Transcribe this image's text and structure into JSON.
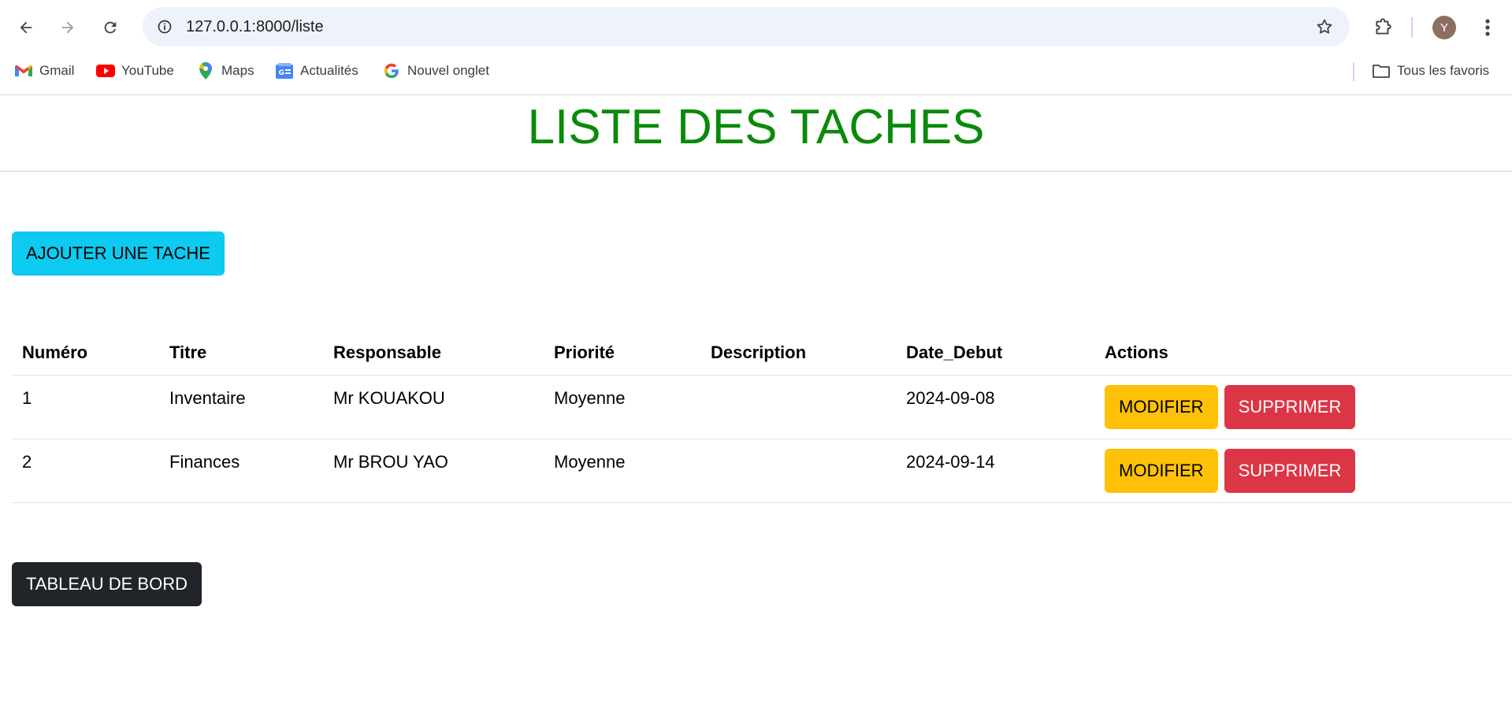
{
  "browser": {
    "url": "127.0.0.1:8000/liste",
    "avatar_letter": "Y",
    "bookmarks": [
      {
        "label": "Gmail",
        "icon": "gmail-icon"
      },
      {
        "label": "YouTube",
        "icon": "youtube-icon"
      },
      {
        "label": "Maps",
        "icon": "maps-icon"
      },
      {
        "label": "Actualités",
        "icon": "news-icon"
      },
      {
        "label": "Nouvel onglet",
        "icon": "google-icon"
      }
    ],
    "all_bookmarks_label": "Tous les favoris"
  },
  "page": {
    "title": "LISTE DES TACHES",
    "add_button": "AJOUTER UNE TACHE",
    "dashboard_button": "TABLEAU DE BORD",
    "title_color": "#0a8a0a"
  },
  "table": {
    "headers": [
      "Numéro",
      "Titre",
      "Responsable",
      "Priorité",
      "Description",
      "Date_Debut",
      "Actions"
    ],
    "rows": [
      {
        "numero": "1",
        "titre": "Inventaire",
        "responsable": "Mr KOUAKOU",
        "priorite": "Moyenne",
        "description": "",
        "date_debut": "2024-09-08"
      },
      {
        "numero": "2",
        "titre": "Finances",
        "responsable": "Mr BROU YAO",
        "priorite": "Moyenne",
        "description": "",
        "date_debut": "2024-09-14"
      }
    ],
    "modify_label": "MODIFIER",
    "delete_label": "SUPPRIMER"
  },
  "colors": {
    "add_button": "#0dcaf0",
    "modify_button": "#ffc107",
    "delete_button": "#dc3545",
    "dashboard_button": "#212529"
  }
}
